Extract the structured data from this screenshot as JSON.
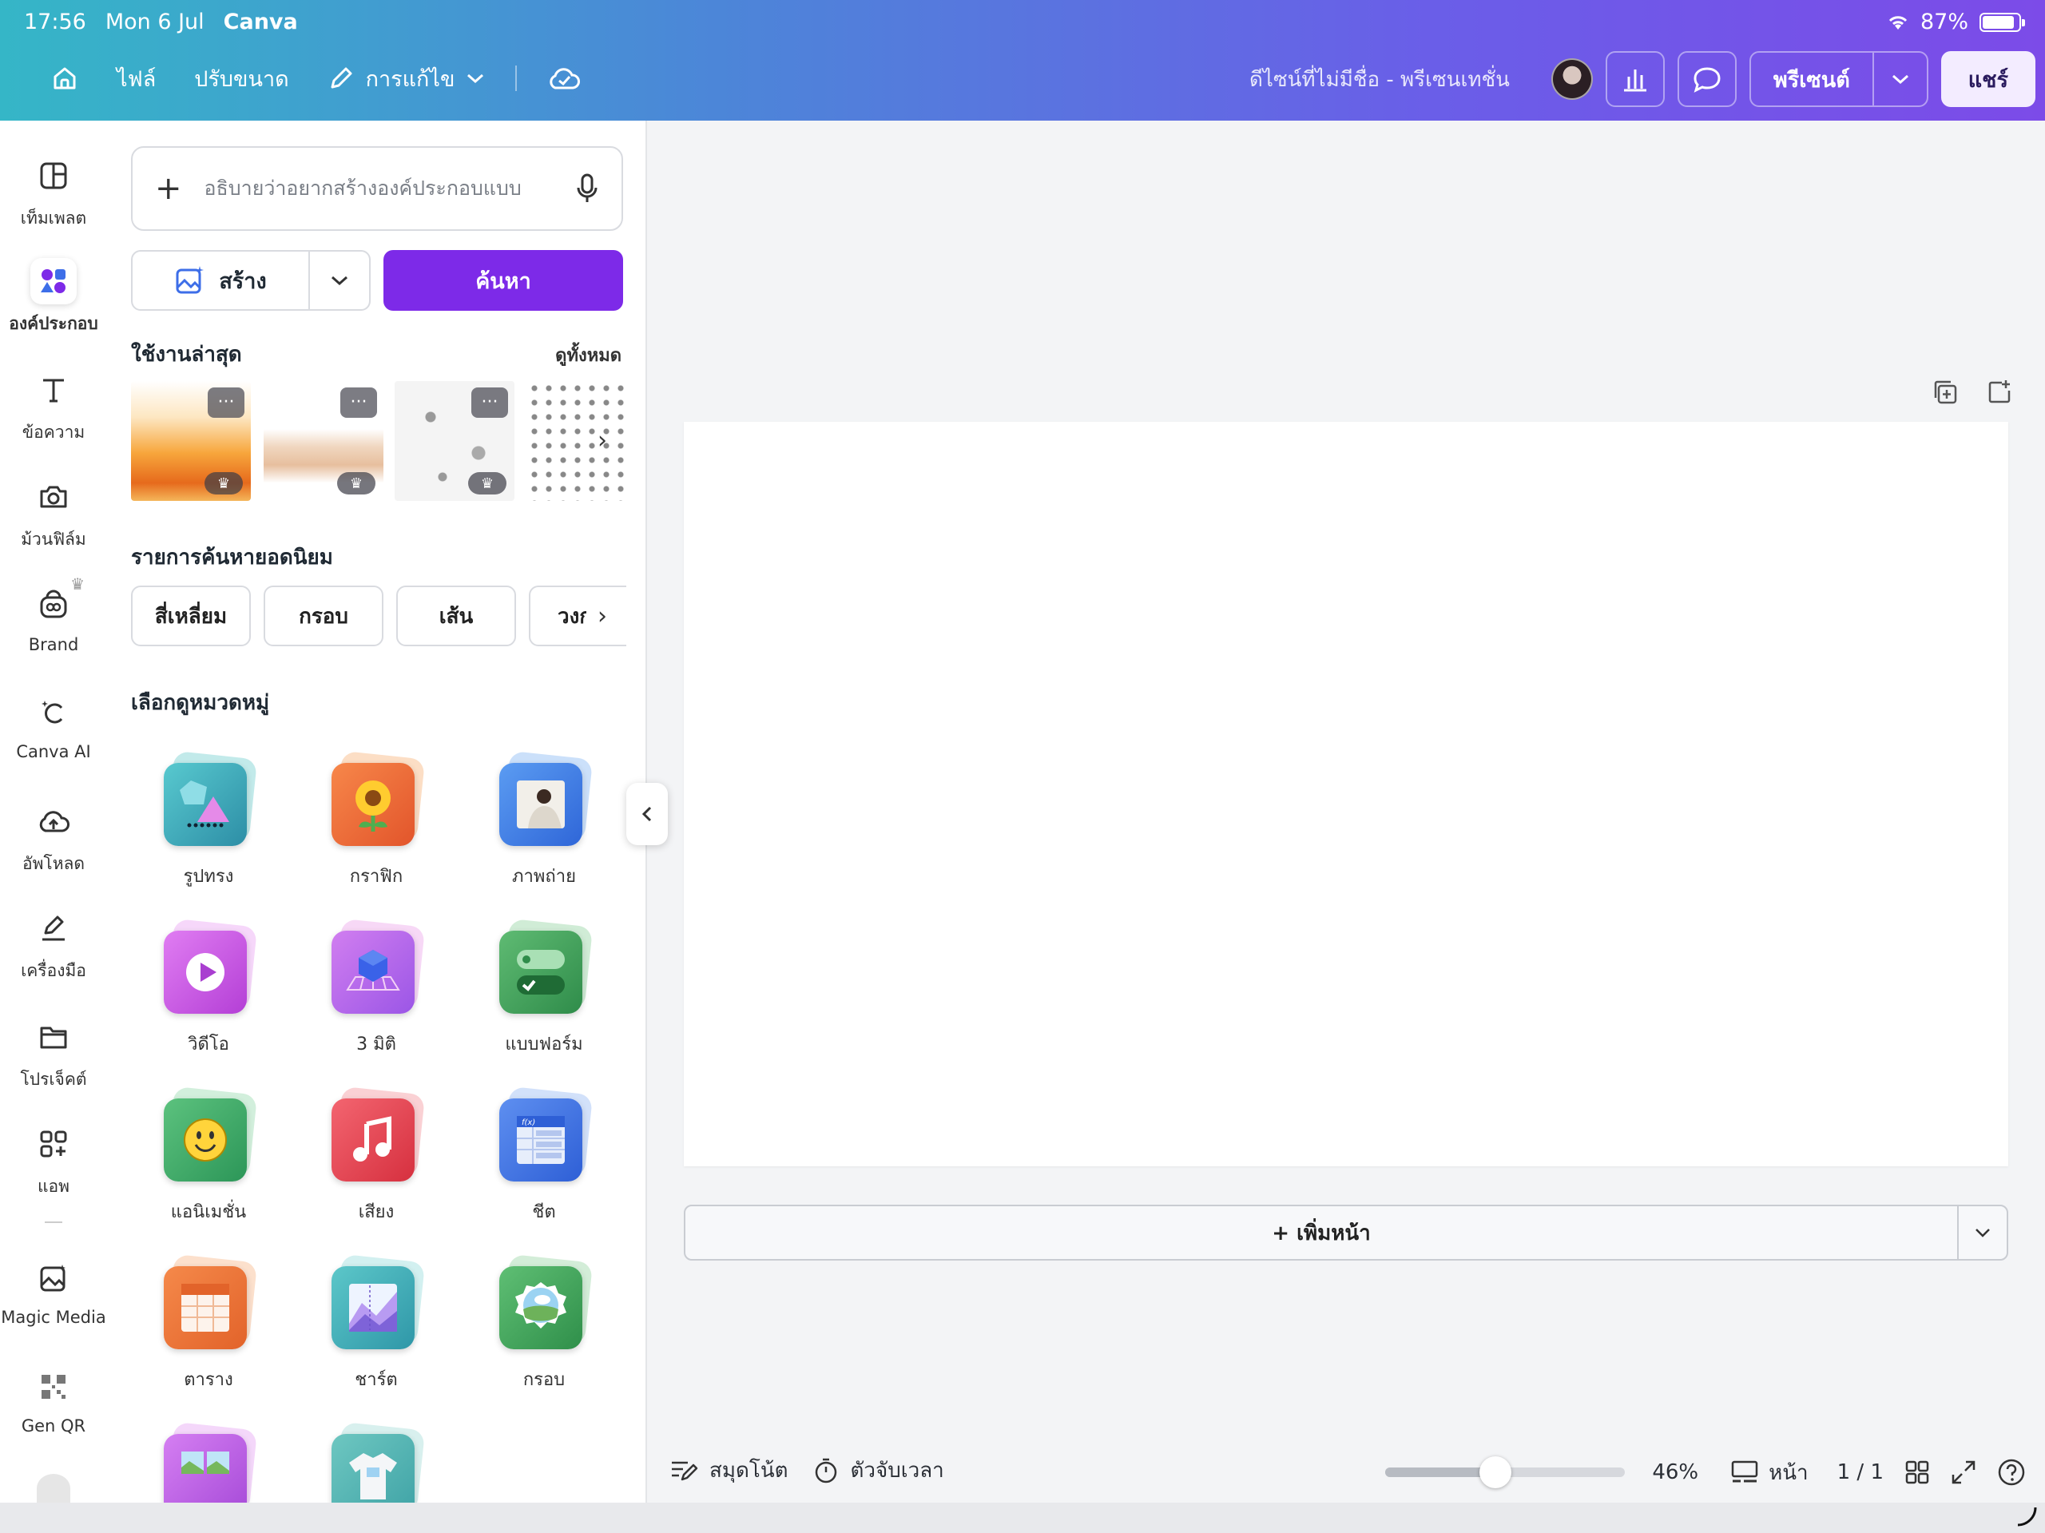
{
  "status": {
    "time": "17:56",
    "date": "Mon 6 Jul",
    "app": "Canva",
    "battery": "87%",
    "battery_level": 0.87
  },
  "toolbar": {
    "file": "ไฟล์",
    "resize": "ปรับขนาด",
    "edit": "การแก้ไข",
    "doc_title": "ดีไซน์ที่ไม่มีชื่อ - พรีเซนเทชั่น",
    "present": "พรีเซนต์",
    "share": "แชร์"
  },
  "rail": [
    {
      "label": "เท็มเพลต",
      "icon": "template-icon"
    },
    {
      "label": "องค์ประกอบ",
      "icon": "elements-icon"
    },
    {
      "label": "ข้อความ",
      "icon": "text-icon"
    },
    {
      "label": "ม้วนฟิล์ม",
      "icon": "camera-icon"
    },
    {
      "label": "Brand",
      "icon": "brand-icon"
    },
    {
      "label": "Canva AI",
      "icon": "canva-ai-icon"
    },
    {
      "label": "อัพโหลด",
      "icon": "upload-icon"
    },
    {
      "label": "เครื่องมือ",
      "icon": "tools-icon"
    },
    {
      "label": "โปรเจ็คต์",
      "icon": "folder-icon"
    },
    {
      "label": "แอพ",
      "icon": "apps-icon"
    },
    {
      "label": "Magic Media",
      "icon": "magic-media-icon"
    },
    {
      "label": "Gen QR",
      "icon": "qr-icon"
    }
  ],
  "panel": {
    "search_placeholder": "อธิบายว่าอยากสร้างองค์ประกอบแบบ",
    "create_label": "สร้าง",
    "search_label": "ค้นหา",
    "recent_title": "ใช้งานล่าสุด",
    "see_all": "ดูทั้งหมด",
    "popular_title": "รายการค้นหายอดนิยม",
    "chips": [
      "สี่เหลี่ยม",
      "กรอบ",
      "เส้น",
      "วงกลม"
    ],
    "browse_title": "เลือกดูหมวดหมู่",
    "categories": [
      {
        "label": "รูปทรง",
        "icon": "shapes-icon"
      },
      {
        "label": "กราฟิก",
        "icon": "graphics-icon"
      },
      {
        "label": "ภาพถ่าย",
        "icon": "photos-icon"
      },
      {
        "label": "วิดีโอ",
        "icon": "video-icon"
      },
      {
        "label": "3 มิติ",
        "icon": "3d-icon"
      },
      {
        "label": "แบบฟอร์ม",
        "icon": "forms-icon"
      },
      {
        "label": "แอนิเมชั่น",
        "icon": "animation-icon"
      },
      {
        "label": "เสียง",
        "icon": "audio-icon"
      },
      {
        "label": "ชีต",
        "icon": "sheets-icon"
      },
      {
        "label": "ตาราง",
        "icon": "table-icon"
      },
      {
        "label": "ชาร์ต",
        "icon": "charts-icon"
      },
      {
        "label": "กรอบ",
        "icon": "frames-icon"
      }
    ]
  },
  "canvas": {
    "add_page": "+ เพิ่มหน้า"
  },
  "bottom": {
    "notes": "สมุดโน้ต",
    "timer": "ตัวจับเวลา",
    "zoom": "46%",
    "zoom_level": 0.46,
    "pages_label": "หน้า",
    "page_count": "1 / 1"
  },
  "colors": {
    "accent": "#7d2ae8",
    "topbar_start": "#35b6c7",
    "topbar_end": "#7c4be8"
  }
}
